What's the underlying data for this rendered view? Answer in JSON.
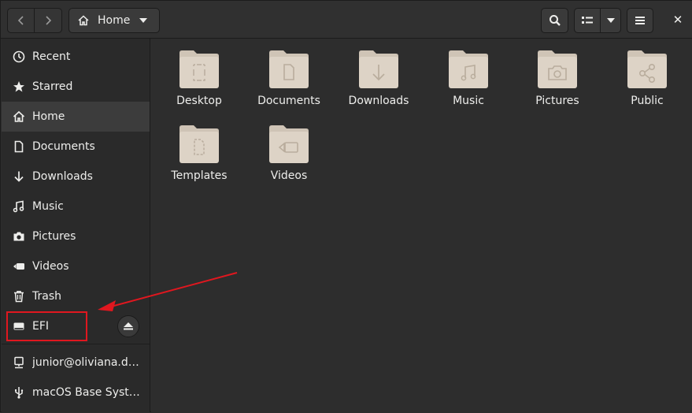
{
  "header": {
    "back_icon": "go-previous-icon",
    "forward_icon": "go-next-icon",
    "path_icon": "home-icon",
    "path_label": "Home",
    "path_dropdown_icon": "pan-down-icon",
    "search_icon": "search-icon",
    "view_icon": "view-list-icon",
    "view_dropdown_icon": "pan-down-icon",
    "menu_icon": "hamburger-menu-icon",
    "close_label": "✕"
  },
  "sidebar": {
    "items": [
      {
        "label": "Recent",
        "icon": "clock-icon"
      },
      {
        "label": "Starred",
        "icon": "star-icon"
      },
      {
        "label": "Home",
        "icon": "home-icon"
      },
      {
        "label": "Documents",
        "icon": "document-icon"
      },
      {
        "label": "Downloads",
        "icon": "download-arrow-icon"
      },
      {
        "label": "Music",
        "icon": "music-note-icon"
      },
      {
        "label": "Pictures",
        "icon": "camera-icon"
      },
      {
        "label": "Videos",
        "icon": "video-camera-icon"
      },
      {
        "label": "Trash",
        "icon": "trash-icon"
      },
      {
        "label": "EFI",
        "icon": "drive-icon"
      }
    ],
    "network": [
      {
        "label": "junior@oliviana.dn…",
        "icon": "network-server-icon"
      },
      {
        "label": "macOS Base Syste…",
        "icon": "usb-icon"
      }
    ],
    "eject_icon": "eject-icon"
  },
  "files": [
    {
      "name": "Desktop",
      "icon": "desktop-folder-icon"
    },
    {
      "name": "Documents",
      "icon": "documents-folder-icon"
    },
    {
      "name": "Downloads",
      "icon": "downloads-folder-icon"
    },
    {
      "name": "Music",
      "icon": "music-folder-icon"
    },
    {
      "name": "Pictures",
      "icon": "pictures-folder-icon"
    },
    {
      "name": "Public",
      "icon": "public-share-folder-icon"
    },
    {
      "name": "Templates",
      "icon": "templates-folder-icon"
    },
    {
      "name": "Videos",
      "icon": "videos-folder-icon"
    }
  ],
  "colors": {
    "folder": "#ddd3c6",
    "folder_tab": "#cfc4b6",
    "folder_glyph": "#b9ad9d",
    "annotation": "#e0171f",
    "active_row": "#3c3c3c"
  }
}
